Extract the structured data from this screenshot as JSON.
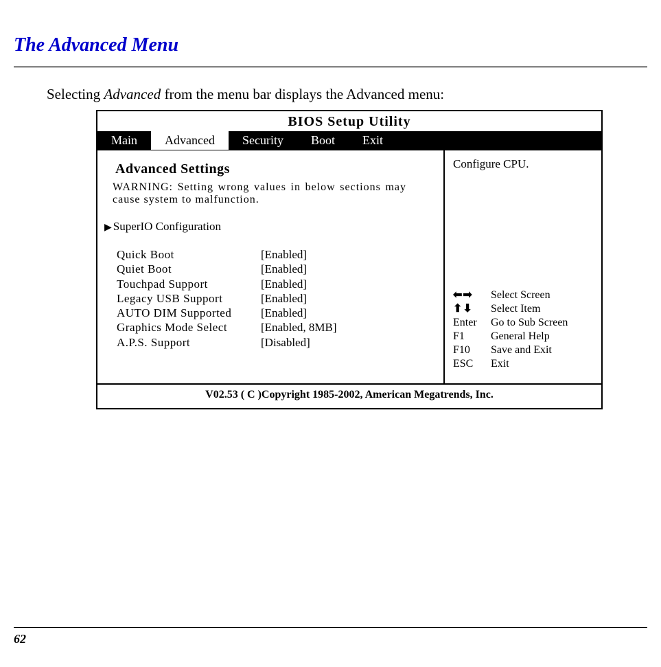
{
  "page": {
    "title": "The Advanced Menu",
    "intro_prefix": "Selecting ",
    "intro_italic": "Advanced",
    "intro_suffix": " from the menu bar displays the Advanced menu:",
    "number": "62"
  },
  "bios": {
    "title": "BIOS Setup Utility",
    "tabs": [
      "Main",
      "Advanced",
      "Security",
      "Boot",
      "Exit"
    ],
    "active_tab_index": 1,
    "section_heading": "Advanced Settings",
    "warning_label": "WARNING",
    "warning_text": ": Setting wrong values in below sections may cause system to malfunction.",
    "submenu": "SuperIO Configuration",
    "settings": [
      {
        "label": "Quick Boot",
        "value": "[Enabled]"
      },
      {
        "label": "Quiet Boot",
        "value": "[Enabled]"
      },
      {
        "label": "Touchpad Support",
        "value": "[Enabled]"
      },
      {
        "label": "Legacy USB Support",
        "value": "[Enabled]"
      },
      {
        "label": "AUTO DIM Supported",
        "value": "[Enabled]"
      },
      {
        "label": "Graphics Mode Select",
        "value": "[Enabled, 8MB]"
      },
      {
        "label": "A.P.S. Support",
        "value": "[Disabled]"
      }
    ],
    "help_text": "Configure CPU.",
    "nav": [
      {
        "key_icon": "lr-arrows",
        "key": "",
        "desc": "Select Screen"
      },
      {
        "key_icon": "ud-arrows",
        "key": "",
        "desc": "Select Item"
      },
      {
        "key_icon": "",
        "key": "Enter",
        "desc": "Go to Sub Screen"
      },
      {
        "key_icon": "",
        "key": "F1",
        "desc": "General Help"
      },
      {
        "key_icon": "",
        "key": "F10",
        "desc": "Save and Exit"
      },
      {
        "key_icon": "",
        "key": "ESC",
        "desc": "Exit"
      }
    ],
    "footer": "V02.53 ( C )Copyright 1985-2002, American Megatrends, Inc."
  }
}
